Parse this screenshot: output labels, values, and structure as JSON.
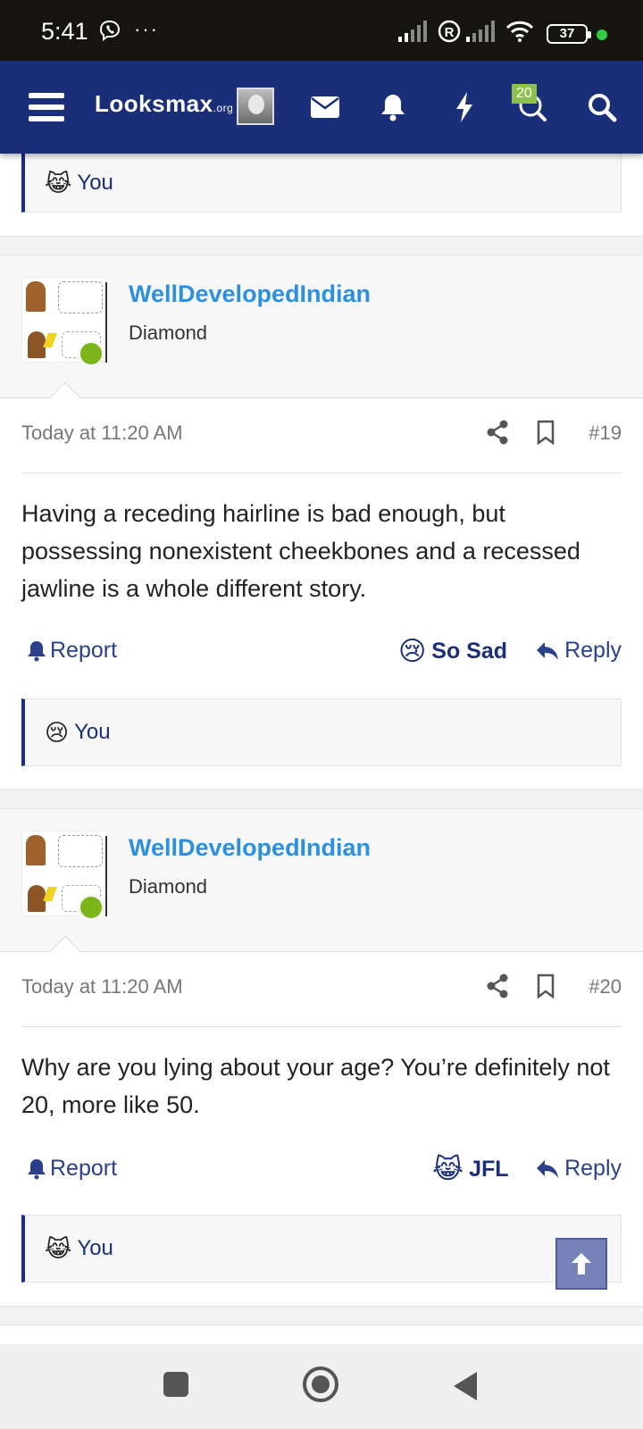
{
  "status_bar": {
    "time": "5:41",
    "battery": "37"
  },
  "app_bar": {
    "brand": "Looksmax",
    "brand_suffix": ".org",
    "notification_badge": "20"
  },
  "top_quote": {
    "emoji": "😹",
    "text": "You"
  },
  "posts": [
    {
      "username": "WellDevelopedIndian",
      "user_title": "Diamond",
      "date": "Today at 11:20 AM",
      "post_number": "#19",
      "text": "Having a receding hairline is bad enough, but possessing nonexistent cheekbones and a recessed jawline is a whole different story.",
      "report_label": "Report",
      "reaction_emoji": "😢",
      "reaction_label": "So Sad",
      "reply_label": "Reply",
      "quote_emoji": "😢",
      "quote_text": "You"
    },
    {
      "username": "WellDevelopedIndian",
      "user_title": "Diamond",
      "date": "Today at 11:20 AM",
      "post_number": "#20",
      "text": "Why are you lying about your age? You’re definitely not 20, more like 50.",
      "report_label": "Report",
      "reaction_emoji": "😹",
      "reaction_label": "JFL",
      "reply_label": "Reply",
      "quote_emoji": "😹",
      "quote_text": "You"
    }
  ],
  "colors": {
    "header": "#1b2e7a",
    "username": "#2d8fe0",
    "online": "#7cb518",
    "badge": "#8bc34a"
  }
}
